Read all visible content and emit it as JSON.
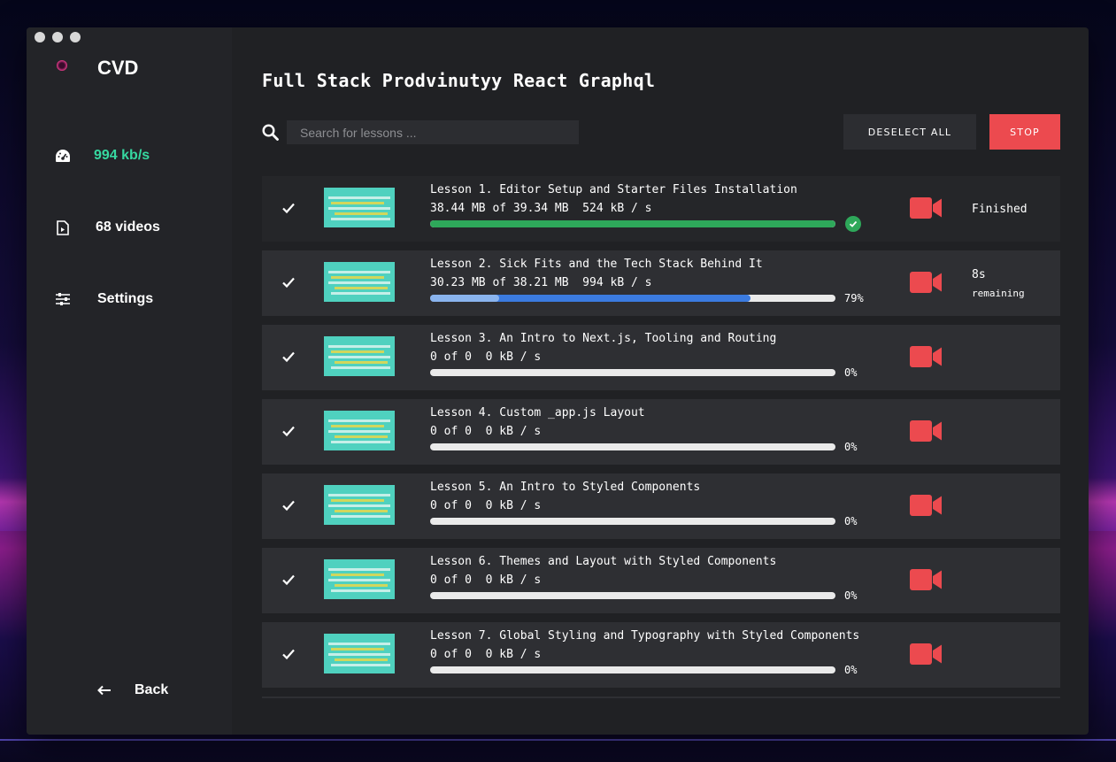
{
  "app": {
    "brand": "CVD"
  },
  "sidebar": {
    "speed": "994 kb/s",
    "videos": "68 videos",
    "settings": "Settings",
    "back": "Back"
  },
  "main": {
    "title": "Full Stack Prodvinutyy React Graphql",
    "search_placeholder": "Search for lessons ...",
    "deselect_label": "DESELECT ALL",
    "stop_label": "STOP"
  },
  "colors": {
    "accent_green": "#36d8a0",
    "stop_red": "#ec4a4f",
    "progress_blue": "#3b7be0",
    "done_green": "#2ea85a"
  },
  "lessons": [
    {
      "title": "Lesson 1. Editor Setup and Starter Files Installation",
      "stats": "38.44 MB of 39.34 MB  524 kB / s",
      "progress": 100,
      "buffer": 0,
      "percent": "",
      "status": "Finished",
      "remaining_time": "",
      "remaining_label": "",
      "done": true,
      "checked": true
    },
    {
      "title": "Lesson 2. Sick Fits and the Tech Stack Behind It",
      "stats": "30.23 MB of 38.21 MB  994 kB / s",
      "progress": 79,
      "buffer": 17,
      "percent": "79%",
      "status": "",
      "remaining_time": "8s",
      "remaining_label": "remaining",
      "done": false,
      "checked": true
    },
    {
      "title": "Lesson 3. An Intro to Next.js, Tooling and Routing",
      "stats": "0 of 0  0 kB / s",
      "progress": 0,
      "buffer": 0,
      "percent": "0%",
      "status": "",
      "remaining_time": "",
      "remaining_label": "",
      "done": false,
      "checked": true
    },
    {
      "title": "Lesson 4. Custom _app.js Layout",
      "stats": "0 of 0  0 kB / s",
      "progress": 0,
      "buffer": 0,
      "percent": "0%",
      "status": "",
      "remaining_time": "",
      "remaining_label": "",
      "done": false,
      "checked": true
    },
    {
      "title": "Lesson 5. An Intro to Styled Components",
      "stats": "0 of 0  0 kB / s",
      "progress": 0,
      "buffer": 0,
      "percent": "0%",
      "status": "",
      "remaining_time": "",
      "remaining_label": "",
      "done": false,
      "checked": true
    },
    {
      "title": "Lesson 6. Themes and Layout with Styled Components",
      "stats": "0 of 0  0 kB / s",
      "progress": 0,
      "buffer": 0,
      "percent": "0%",
      "status": "",
      "remaining_time": "",
      "remaining_label": "",
      "done": false,
      "checked": true
    },
    {
      "title": "Lesson 7. Global Styling and Typography with Styled Components",
      "stats": "0 of 0  0 kB / s",
      "progress": 0,
      "buffer": 0,
      "percent": "0%",
      "status": "",
      "remaining_time": "",
      "remaining_label": "",
      "done": false,
      "checked": true
    }
  ]
}
